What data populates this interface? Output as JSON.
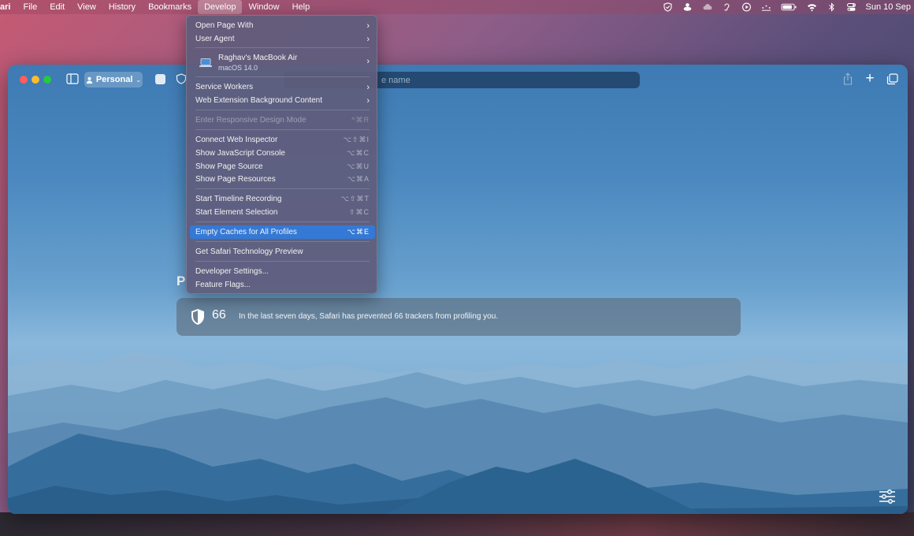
{
  "menubar": {
    "app_name": "ari",
    "items": [
      "File",
      "Edit",
      "View",
      "History",
      "Bookmarks",
      "Develop",
      "Window",
      "Help"
    ],
    "active_item": "Develop",
    "clock": "Sun 10 Sep",
    "status_icons": [
      "shield-check-icon",
      "cloud-drop-icon",
      "cloud-icon",
      "hearing-icon",
      "play-circle-icon",
      "dots-icon",
      "battery-icon",
      "wifi-icon",
      "bluetooth-icon",
      "control-center-icon"
    ]
  },
  "toolbar": {
    "profile_label": "Personal",
    "address_placeholder": "e name"
  },
  "develop_menu": {
    "open_page_with": "Open Page With",
    "user_agent": "User Agent",
    "device_name": "Raghav's MacBook Air",
    "device_os": "macOS 14.0",
    "service_workers": "Service Workers",
    "web_extension_bg": "Web Extension Background Content",
    "responsive_design": "Enter Responsive Design Mode",
    "responsive_design_sc": "^⌘R",
    "connect_inspector": "Connect Web Inspector",
    "connect_inspector_sc": "⌥⇧⌘I",
    "js_console": "Show JavaScript Console",
    "js_console_sc": "⌥⌘C",
    "page_source": "Show Page Source",
    "page_source_sc": "⌥⌘U",
    "page_resources": "Show Page Resources",
    "page_resources_sc": "⌥⌘A",
    "timeline": "Start Timeline Recording",
    "timeline_sc": "⌥⇧⌘T",
    "element_selection": "Start Element Selection",
    "element_selection_sc": "⇧⌘C",
    "empty_caches": "Empty Caches for All Profiles",
    "empty_caches_sc": "⌥⌘E",
    "tech_preview": "Get Safari Technology Preview",
    "dev_settings": "Developer Settings...",
    "feature_flags": "Feature Flags..."
  },
  "privacy": {
    "heading_initial": "P",
    "count": "66",
    "message": "In the last seven days, Safari has prevented 66 trackers from profiling you."
  },
  "colors": {
    "highlight": "#3479d6",
    "close": "#ff5f57",
    "minimize": "#febc2e",
    "zoom": "#28c840"
  }
}
